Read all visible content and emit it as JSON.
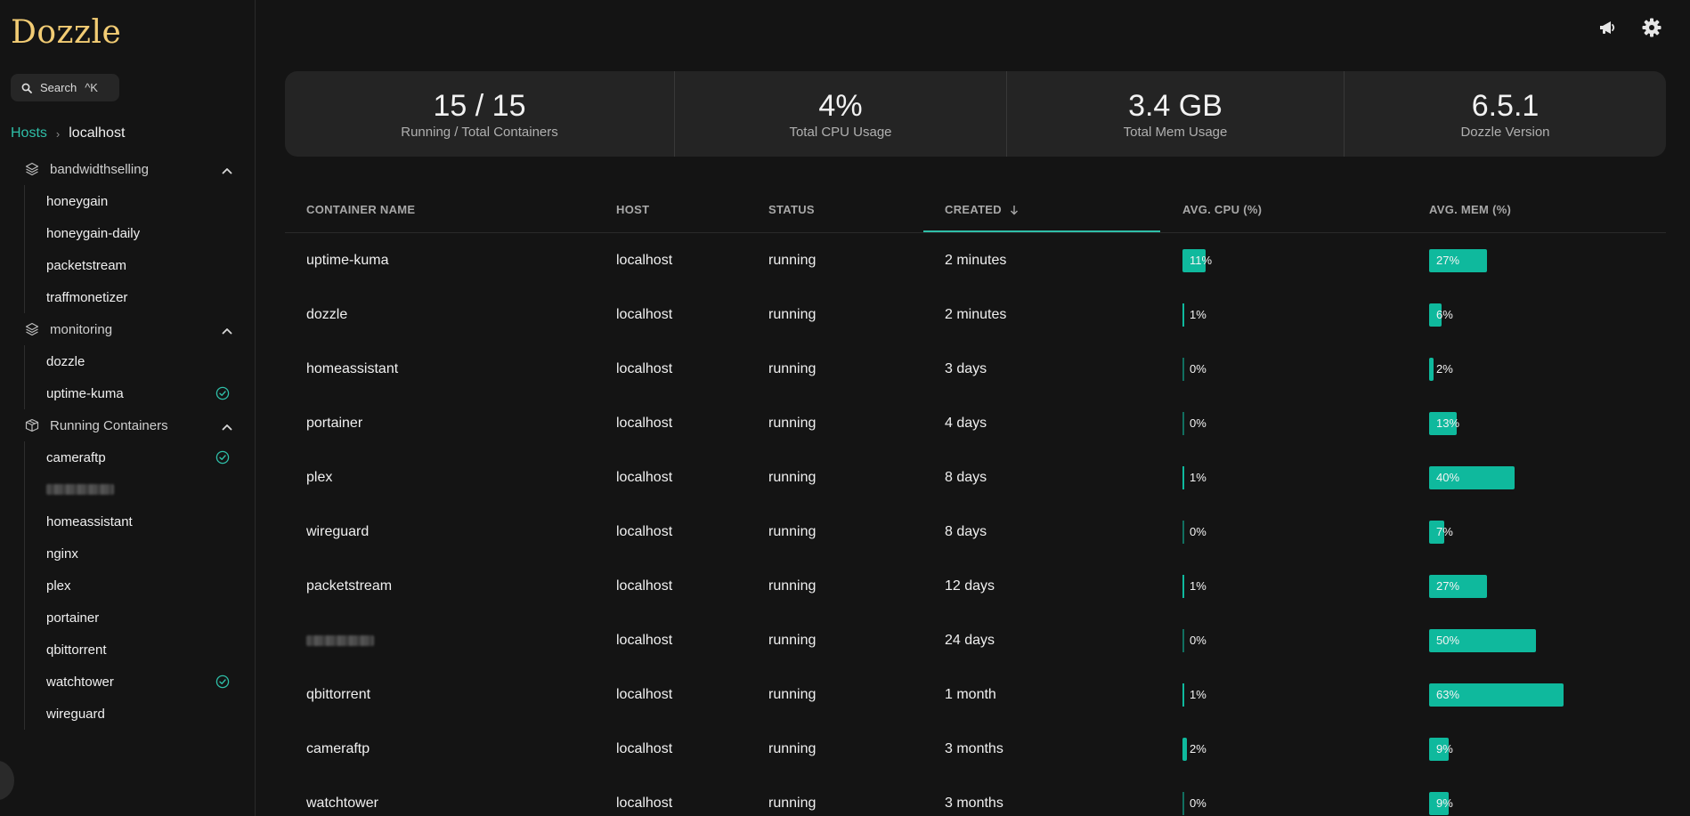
{
  "app": {
    "logo": "Dozzle"
  },
  "search": {
    "label": "Search",
    "shortcut": "^K"
  },
  "breadcrumb": {
    "root": "Hosts",
    "current": "localhost"
  },
  "sidebar": {
    "groups": [
      {
        "name": "bandwidthselling",
        "icon": "stack-icon",
        "items": [
          {
            "label": "honeygain",
            "check": false
          },
          {
            "label": "honeygain-daily",
            "check": false
          },
          {
            "label": "packetstream",
            "check": false
          },
          {
            "label": "traffmonetizer",
            "check": false
          }
        ]
      },
      {
        "name": "monitoring",
        "icon": "stack-icon",
        "items": [
          {
            "label": "dozzle",
            "check": false
          },
          {
            "label": "uptime-kuma",
            "check": true
          }
        ]
      },
      {
        "name": "Running Containers",
        "icon": "box-icon",
        "items": [
          {
            "label": "cameraftp",
            "check": true
          },
          {
            "label": "",
            "blurred": true,
            "check": false
          },
          {
            "label": "homeassistant",
            "check": false
          },
          {
            "label": "nginx",
            "check": false
          },
          {
            "label": "plex",
            "check": false
          },
          {
            "label": "portainer",
            "check": false
          },
          {
            "label": "qbittorrent",
            "check": false
          },
          {
            "label": "watchtower",
            "check": true
          },
          {
            "label": "wireguard",
            "check": false
          }
        ]
      }
    ]
  },
  "stats": [
    {
      "value": "15 / 15",
      "label": "Running / Total Containers"
    },
    {
      "value": "4%",
      "label": "Total CPU Usage"
    },
    {
      "value": "3.4 GB",
      "label": "Total Mem Usage"
    },
    {
      "value": "6.5.1",
      "label": "Dozzle Version"
    }
  ],
  "table": {
    "headers": [
      "CONTAINER NAME",
      "HOST",
      "STATUS",
      "CREATED",
      "AVG. CPU (%)",
      "AVG. MEM (%)"
    ],
    "sort_column": "CREATED",
    "rows": [
      {
        "name": "uptime-kuma",
        "host": "localhost",
        "status": "running",
        "created": "2 minutes",
        "cpu": 11,
        "cpu_label": "11%",
        "mem": 27,
        "mem_label": "27%"
      },
      {
        "name": "dozzle",
        "host": "localhost",
        "status": "running",
        "created": "2 minutes",
        "cpu": 1,
        "cpu_label": "1%",
        "mem": 6,
        "mem_label": "6%"
      },
      {
        "name": "homeassistant",
        "host": "localhost",
        "status": "running",
        "created": "3 days",
        "cpu": 0,
        "cpu_label": "0%",
        "mem": 2,
        "mem_label": "2%"
      },
      {
        "name": "portainer",
        "host": "localhost",
        "status": "running",
        "created": "4 days",
        "cpu": 0,
        "cpu_label": "0%",
        "mem": 13,
        "mem_label": "13%"
      },
      {
        "name": "plex",
        "host": "localhost",
        "status": "running",
        "created": "8 days",
        "cpu": 1,
        "cpu_label": "1%",
        "mem": 40,
        "mem_label": "40%"
      },
      {
        "name": "wireguard",
        "host": "localhost",
        "status": "running",
        "created": "8 days",
        "cpu": 0,
        "cpu_label": "0%",
        "mem": 7,
        "mem_label": "7%"
      },
      {
        "name": "packetstream",
        "host": "localhost",
        "status": "running",
        "created": "12 days",
        "cpu": 1,
        "cpu_label": "1%",
        "mem": 27,
        "mem_label": "27%"
      },
      {
        "name": "",
        "blurred": true,
        "host": "localhost",
        "status": "running",
        "created": "24 days",
        "cpu": 0,
        "cpu_label": "0%",
        "mem": 50,
        "mem_label": "50%"
      },
      {
        "name": "qbittorrent",
        "host": "localhost",
        "status": "running",
        "created": "1 month",
        "cpu": 1,
        "cpu_label": "1%",
        "mem": 63,
        "mem_label": "63%"
      },
      {
        "name": "cameraftp",
        "host": "localhost",
        "status": "running",
        "created": "3 months",
        "cpu": 2,
        "cpu_label": "2%",
        "mem": 9,
        "mem_label": "9%"
      },
      {
        "name": "watchtower",
        "host": "localhost",
        "status": "running",
        "created": "3 months",
        "cpu": 0,
        "cpu_label": "0%",
        "mem": 9,
        "mem_label": "9%"
      }
    ]
  },
  "colors": {
    "accent": "#0fb99d",
    "link": "#2fbfa8",
    "logo": "#f2cc74",
    "background": "#141414",
    "panel": "#242424"
  },
  "icons": {
    "announcement": "megaphone-icon",
    "settings": "gear-icon"
  }
}
